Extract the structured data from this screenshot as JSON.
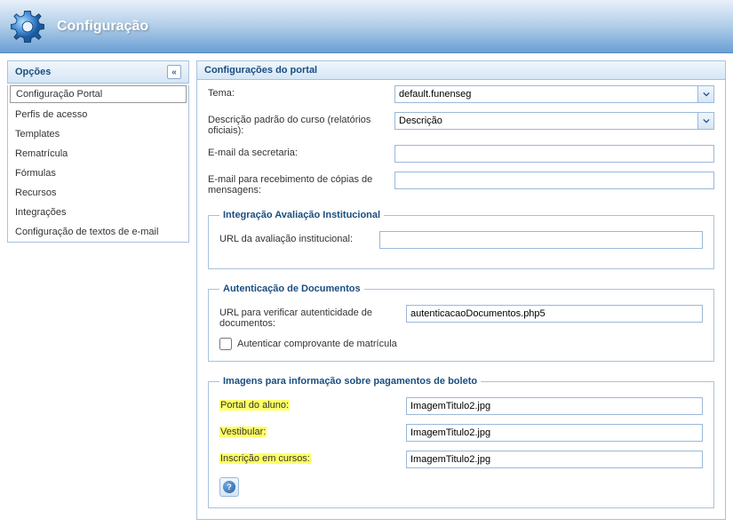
{
  "header": {
    "title": "Configuração"
  },
  "sidebar": {
    "title": "Opções",
    "items": [
      {
        "label": "Configuração Portal",
        "active": true
      },
      {
        "label": "Perfis de acesso",
        "active": false
      },
      {
        "label": "Templates",
        "active": false
      },
      {
        "label": "Rematrícula",
        "active": false
      },
      {
        "label": "Fórmulas",
        "active": false
      },
      {
        "label": "Recursos",
        "active": false
      },
      {
        "label": "Integrações",
        "active": false
      },
      {
        "label": "Configuração de textos de e-mail",
        "active": false
      }
    ]
  },
  "content": {
    "title": "Configurações do portal",
    "tema": {
      "label": "Tema:",
      "value": "default.funenseg"
    },
    "descricao": {
      "label": "Descrição padrão do curso (relatórios oficiais):",
      "value": "Descrição"
    },
    "emailSecretaria": {
      "label": "E-mail da secretaria:",
      "value": ""
    },
    "emailCopias": {
      "label": "E-mail para recebimento de cópias de mensagens:",
      "value": ""
    },
    "integracao": {
      "legend": "Integração Avaliação Institucional",
      "urlLabel": "URL da avaliação institucional:",
      "urlValue": ""
    },
    "autenticacao": {
      "legend": "Autenticação de Documentos",
      "urlLabel": "URL para verificar autenticidade de documentos:",
      "urlValue": "autenticacaoDocumentos.php5",
      "checkLabel": "Autenticar comprovante de matrícula"
    },
    "imagens": {
      "legend": "Imagens para informação sobre pagamentos de boleto",
      "portalLabel": "Portal do aluno:",
      "portalValue": "ImagemTitulo2.jpg",
      "vestibularLabel": "Vestibular:",
      "vestibularValue": "ImagemTitulo2.jpg",
      "inscricaoLabel": "Inscrição em cursos:",
      "inscricaoValue": "ImagemTitulo2.jpg"
    }
  }
}
